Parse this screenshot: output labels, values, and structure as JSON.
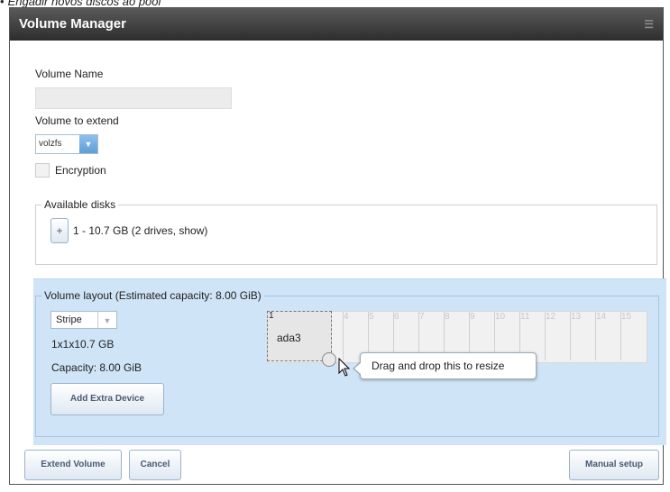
{
  "caption": {
    "text": "Engadir novos discos ao pool"
  },
  "dialog": {
    "title": "Volume Manager"
  },
  "form": {
    "volume_name_label": "Volume Name",
    "volume_name_value": "",
    "volume_to_extend_label": "Volume to extend",
    "volume_to_extend_value": "volzfs",
    "encryption_label": "Encryption",
    "available_disks_legend": "Available disks",
    "add_disk_label": "+",
    "available_disk_text": "1 - 10.7 GB (2 drives, show)"
  },
  "layout": {
    "legend": "Volume layout (Estimated capacity: 8.00 GiB)",
    "type_value": "Stripe",
    "vdev_text": "1x1x10.7 GB",
    "capacity_text": "Capacity: 8.00 GiB",
    "add_extra_device_label": "Add Extra Device",
    "columns": [
      "1",
      "2",
      "3",
      "4",
      "5",
      "6",
      "7",
      "8",
      "9",
      "10",
      "11",
      "12",
      "13",
      "14",
      "15"
    ],
    "disk_name": "ada3",
    "tooltip_text": "Drag and drop this to resize"
  },
  "footer": {
    "extend_volume_label": "Extend Volume",
    "cancel_label": "Cancel",
    "manual_setup_label": "Manual setup"
  },
  "colors": {
    "layout_bg": "#cfe4f6",
    "title_bar": "#3a3a3a",
    "button_text": "#4a5b72"
  }
}
